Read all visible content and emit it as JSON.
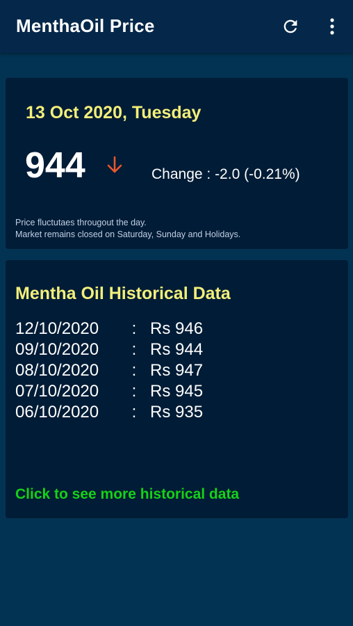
{
  "app": {
    "title": "MenthaOil Price",
    "icons": {
      "refresh": "refresh-icon",
      "more": "more-vert-icon"
    }
  },
  "price_card": {
    "date": "13 Oct 2020, Tuesday",
    "price": "944",
    "direction": "down",
    "direction_icon": "arrow-down-icon",
    "change": "Change : -2.0 (-0.21%)",
    "note_line1": "Price fluctutaes througout the day.",
    "note_line2": "Market remains closed on Saturday, Sunday and Holidays."
  },
  "history": {
    "title": "Mentha Oil Historical Data",
    "separator": ":",
    "rows": [
      {
        "date": "12/10/2020",
        "price": "Rs 946"
      },
      {
        "date": "09/10/2020",
        "price": "Rs 944"
      },
      {
        "date": "08/10/2020",
        "price": "Rs 947"
      },
      {
        "date": "07/10/2020",
        "price": "Rs 945"
      },
      {
        "date": "06/10/2020",
        "price": "Rs 935"
      }
    ],
    "more_link": "Click to see more historical data"
  },
  "colors": {
    "background": "#033352",
    "app_bar": "#05284a",
    "card": "#011c36",
    "heading_yellow": "#f2ef7a",
    "link_green": "#16d116",
    "down_arrow": "#e8572e"
  }
}
